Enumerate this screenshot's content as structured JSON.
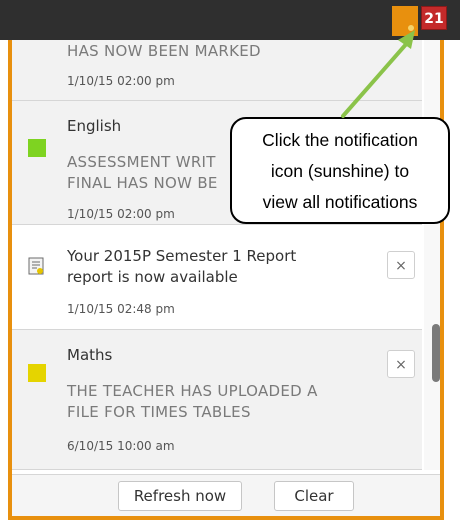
{
  "header": {
    "notification_count": "21"
  },
  "notifications": [
    {
      "message": "HAS NOW BEEN MARKED",
      "date": "1/10/15 02:00 pm"
    },
    {
      "subject": "English",
      "subject_color": "#7ed321",
      "message_line1": "ASSESSMENT WRIT",
      "message_line2": "FINAL HAS NOW BE",
      "date": "1/10/15 02:00 pm"
    },
    {
      "title_line1": "Your 2015P Semester 1 Report",
      "title_line2": "report is now available",
      "date": "1/10/15 02:48 pm",
      "icon": "report-document-icon",
      "close_label": "×"
    },
    {
      "subject": "Maths",
      "subject_color": "#e5d400",
      "message_line1": "THE TEACHER HAS UPLOADED A",
      "message_line2": "FILE FOR TIMES TABLES",
      "date": "6/10/15 10:00 am",
      "close_label": "×"
    }
  ],
  "footer": {
    "refresh_label": "Refresh now",
    "clear_label": "Clear"
  },
  "callout": {
    "line1": "Click the notification",
    "line2": "icon (sunshine) to",
    "line3": "view all notifications"
  },
  "colors": {
    "accent": "#e8900e",
    "badge": "#c42a2a",
    "arrow": "#8bc34a"
  }
}
